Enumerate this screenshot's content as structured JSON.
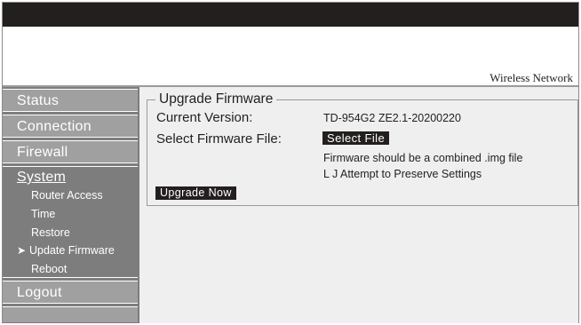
{
  "header": {
    "brand": "Wireless Network"
  },
  "sidebar": {
    "items": [
      {
        "label": "Status"
      },
      {
        "label": "Connection"
      },
      {
        "label": "Firewall"
      },
      {
        "label": "System"
      },
      {
        "label": "Logout"
      }
    ],
    "system_subitems": [
      {
        "label": "Router Access"
      },
      {
        "label": "Time"
      },
      {
        "label": "Restore"
      },
      {
        "label": "Update Firmware",
        "current": true,
        "marker": "➤"
      },
      {
        "label": "Reboot"
      }
    ]
  },
  "main": {
    "section_title": "Upgrade Firmware",
    "current_version_label": "Current Version:",
    "current_version_value": "TD-954G2 ZE2.1-20200220",
    "select_file_label": "Select Firmware File:",
    "select_file_button": "Select File",
    "note": "Firmware should be a combined .img file",
    "preserve_checkbox_label": "L J Attempt to Preserve Settings",
    "upgrade_button": "Upgrade Now"
  },
  "colors": {
    "topbar": "#231f1e",
    "sidebar": "#7d7d7d",
    "nav_item": "#a0a0a0",
    "content_bg": "#efefef"
  }
}
